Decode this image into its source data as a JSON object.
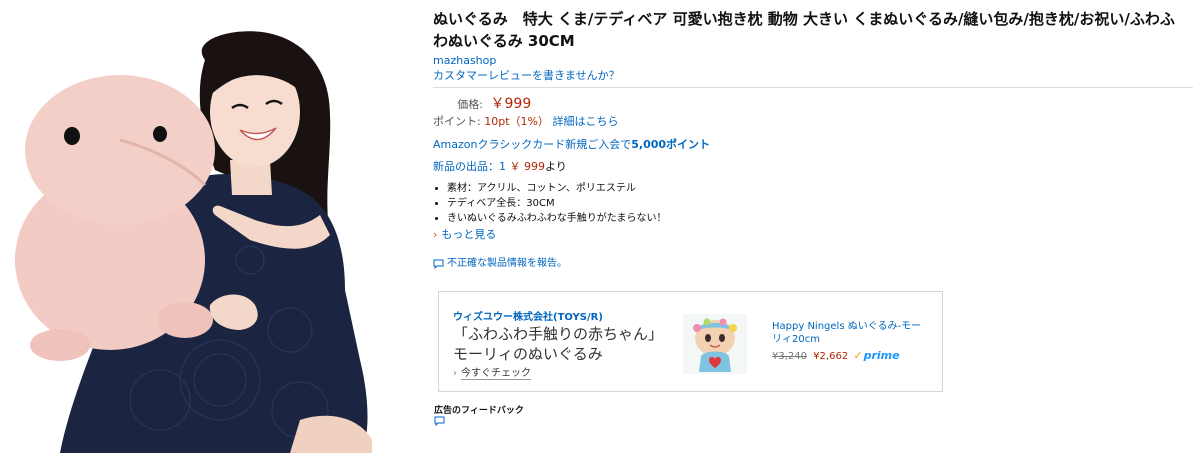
{
  "product": {
    "title": "ぬいぐるみ　特大 くま/テディベア 可愛い抱き枕 動物 大きい くまぬいぐるみ/縫い包み/抱き枕/お祝い/ふわふわぬいぐるみ 30CM",
    "brand": "mazhashop",
    "review_link": "カスタマーレビューを書きませんか？"
  },
  "pricing": {
    "price_label": "価格:",
    "price": "￥999",
    "points_label": "ポイント:",
    "points_value": "10pt（1%）",
    "points_detail_link": "詳細はこちら",
    "card_text": "Amazonクラシックカード新規ご入会で",
    "card_points": "5,000ポイント",
    "new_label": "新品の出品：1",
    "new_price": "￥ 999",
    "new_suffix": "より"
  },
  "features": [
    "素材：アクリル、コットン、ポリエステル",
    "テディベア全長：30CM",
    "きいぬいぐるみふわふわな手触りがたまらない！"
  ],
  "more_link": "もっと見る",
  "report_link": "不正確な製品情報を報告。",
  "ad": {
    "company": "ウィズユウー株式会社(TOYS/R)",
    "headline": "「ふわふわ手触りの赤ちゃん」モーリィのぬいぐるみ",
    "cta": "今すぐチェック",
    "product_name": "Happy Ningels ぬいぐるみ-モーリィ20cm",
    "old_price": "¥3,240",
    "new_price": "¥2,662",
    "prime_label": "prime"
  },
  "feedback_label": "広告のフィードバック",
  "colors": {
    "link": "#0066c0",
    "price": "#b12704",
    "prime": "#1a98ff",
    "plush": "#f2cbc4",
    "dress": "#1b2542"
  },
  "icons": [
    "chevron-right-icon",
    "speech-bubble-icon",
    "prime-check-icon"
  ]
}
